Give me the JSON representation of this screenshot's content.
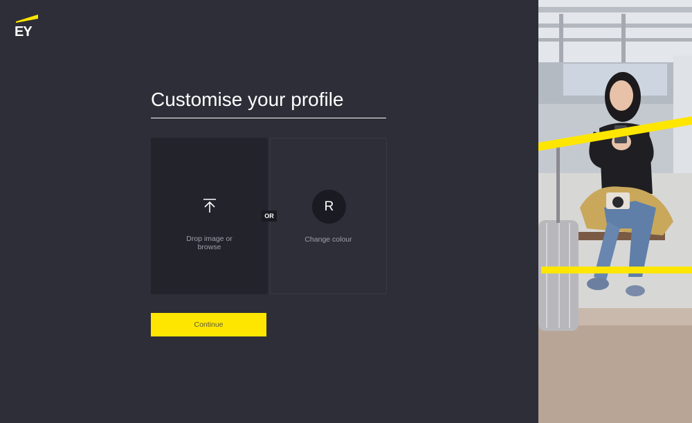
{
  "brand": {
    "logo_text": "EY",
    "accent_color": "#ffe600",
    "background_color": "#2e2e38"
  },
  "header": {
    "title": "Customise your profile"
  },
  "options": {
    "upload": {
      "icon": "upload-arrow-icon",
      "label": "Drop image or browse"
    },
    "separator": "OR",
    "colour": {
      "avatar_initial": "R",
      "label": "Change colour"
    }
  },
  "actions": {
    "continue_label": "Continue"
  }
}
